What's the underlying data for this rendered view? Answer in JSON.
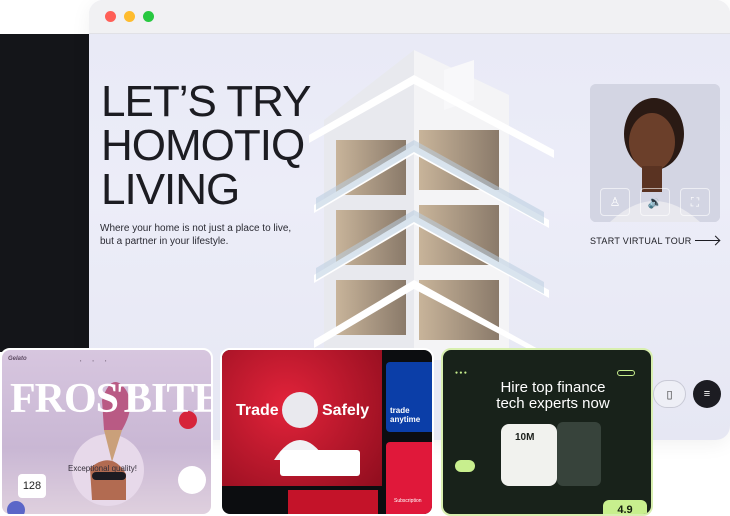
{
  "hero": {
    "title": "LET’S TRY\nHOMOTIQ\nLIVING",
    "subtitle": "Where your home is not just a place to live, but a partner in your lifestyle."
  },
  "tour": {
    "link": "START VIRTUAL TOUR",
    "controls": [
      "person-icon",
      "volume-icon",
      "fullscreen-icon"
    ]
  },
  "cards": {
    "frost": {
      "left": "FROST",
      "right": "BITES",
      "count": "128",
      "quality": "Exceptional quality!"
    },
    "trade": {
      "left": "Trade",
      "right": "Safely",
      "side": "trade\nanytime",
      "sub": "Subscription"
    },
    "finance": {
      "headline": "Hire top finance\ntech experts now",
      "amount": "10M",
      "rating": "4.9"
    }
  },
  "colors": {
    "accent": "#c8ef8e",
    "red": "#e2233a",
    "dark": "#1c1c22"
  }
}
